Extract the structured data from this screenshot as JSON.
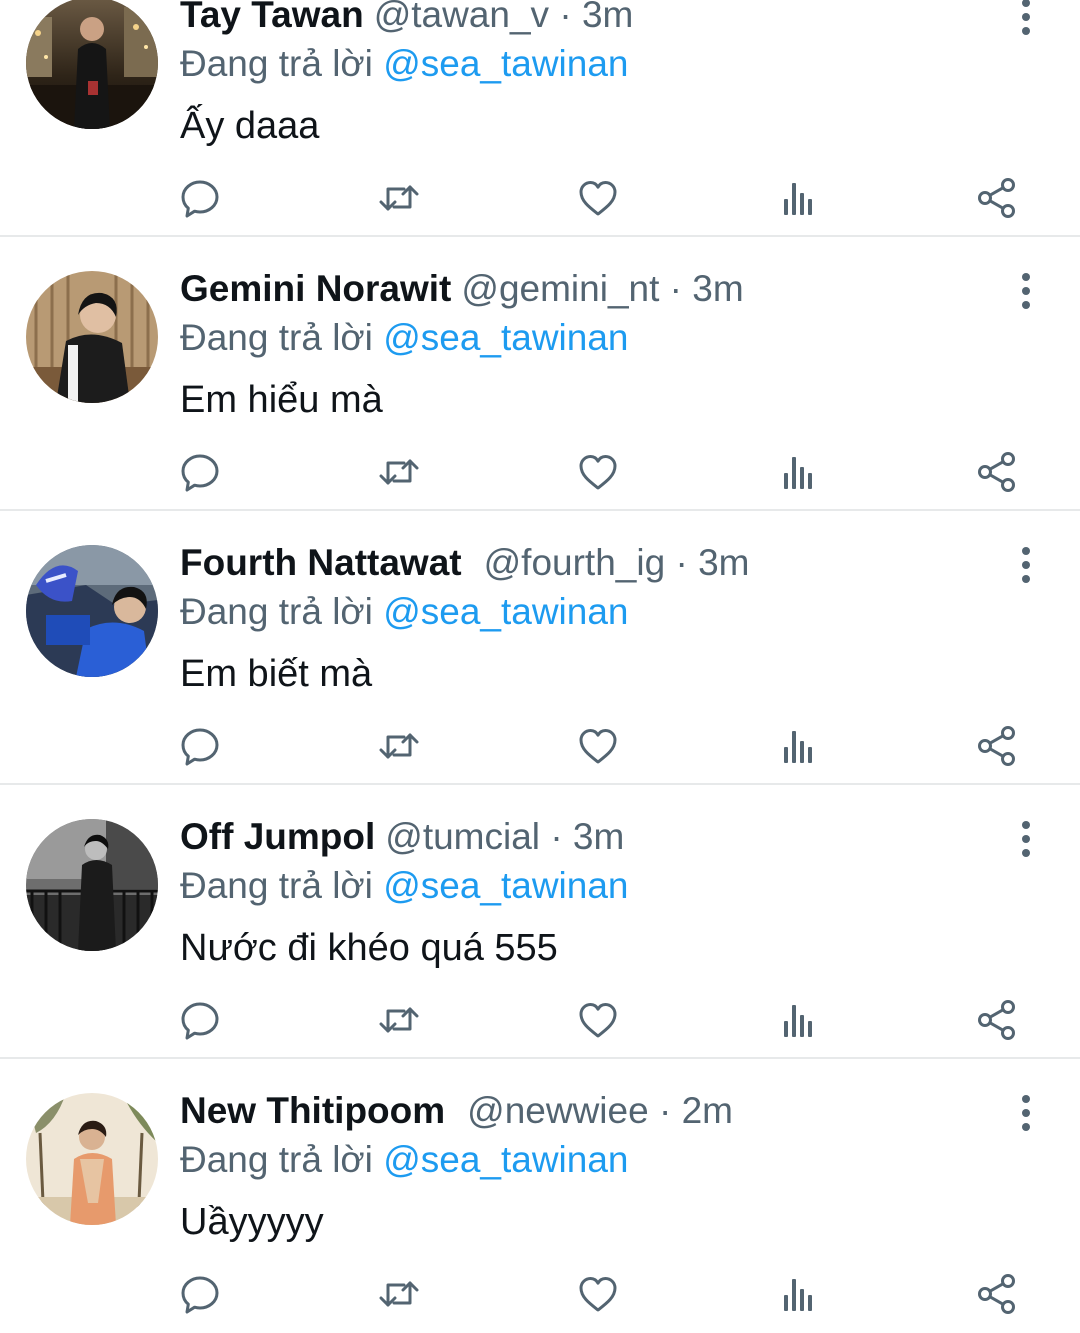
{
  "tweets": [
    {
      "name": "Tay Tawan",
      "handle": "@tawan_v",
      "separator": "·",
      "time": "3m",
      "replying_prefix": "Đang trả lời",
      "replying_to": "@sea_tawinan",
      "text": "Ấy daaa"
    },
    {
      "name": "Gemini Norawit",
      "handle": "@gemini_nt",
      "separator": "·",
      "time": "3m",
      "replying_prefix": "Đang trả lời",
      "replying_to": "@sea_tawinan",
      "text": "Em hiểu mà"
    },
    {
      "name": "Fourth Nattawat",
      "handle": "@fourth_ig",
      "separator": "·",
      "time": "3m",
      "replying_prefix": "Đang trả lời",
      "replying_to": "@sea_tawinan",
      "text": "Em biết mà"
    },
    {
      "name": "Off Jumpol",
      "handle": "@tumcial",
      "separator": "·",
      "time": "3m",
      "replying_prefix": "Đang trả lời",
      "replying_to": "@sea_tawinan",
      "text": "Nước đi khéo quá 555"
    },
    {
      "name": "New Thitipoom",
      "handle": "@newwiee",
      "separator": "·",
      "time": "2m",
      "replying_prefix": "Đang trả lời",
      "replying_to": "@sea_tawinan",
      "text": "Uầyyyyy"
    }
  ],
  "icons": {
    "more": "more-vertical-icon",
    "reply": "reply-bubble-icon",
    "retweet": "retweet-icon",
    "like": "heart-icon",
    "views": "views-bar-chart-icon",
    "share": "share-icon"
  },
  "colors": {
    "text": "#0f1419",
    "secondary": "#536471",
    "accent": "#1d9bf0",
    "divider": "#e7e9ea"
  }
}
